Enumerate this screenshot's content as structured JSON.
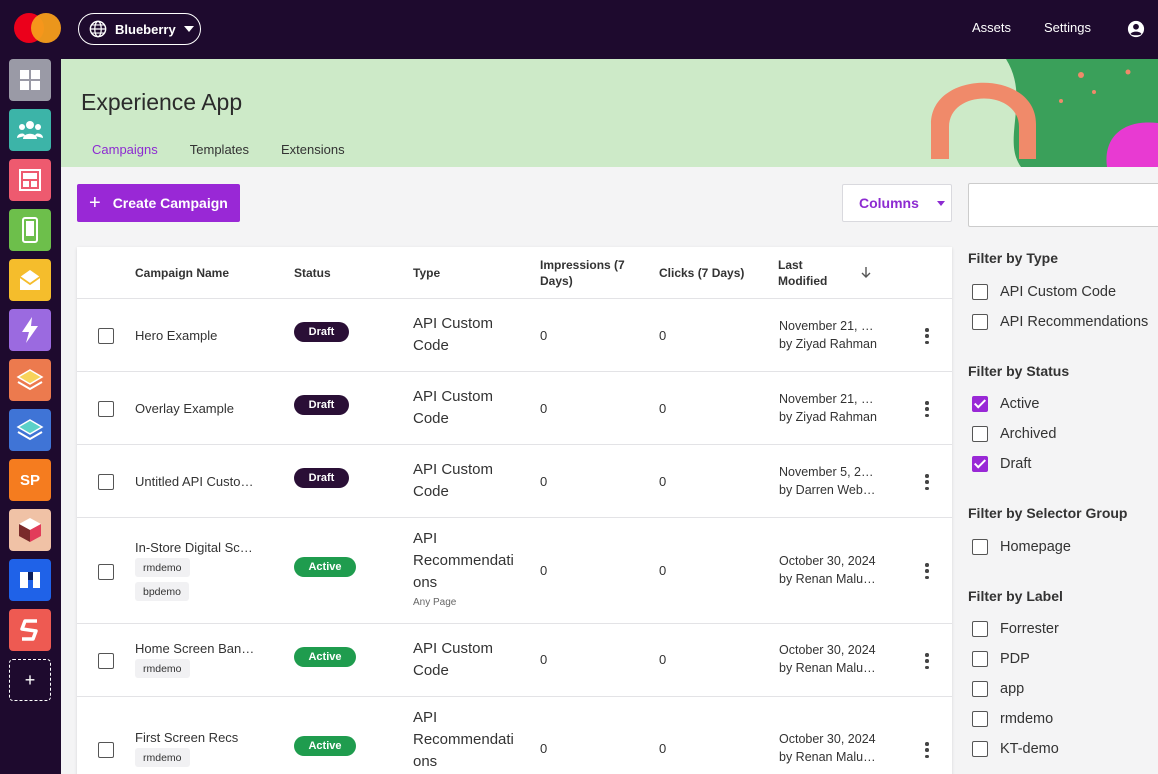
{
  "topbar": {
    "workspace": "Blueberry",
    "nav": [
      "Assets",
      "Settings"
    ]
  },
  "rail": {
    "add_label": "+",
    "sp_label": "SP"
  },
  "header": {
    "title": "Experience App",
    "tabs": [
      "Campaigns",
      "Templates",
      "Extensions"
    ],
    "active_tab": "Campaigns"
  },
  "toolbar": {
    "create_label": "Create Campaign",
    "columns_label": "Columns",
    "search_placeholder": ""
  },
  "table": {
    "headers": {
      "name": "Campaign Name",
      "status": "Status",
      "type": "Type",
      "impressions": "Impressions (7 Days)",
      "clicks": "Clicks (7 Days)",
      "modified": "Last Modified"
    },
    "rows": [
      {
        "name": "Hero Example",
        "status": "Draft",
        "type_l1": "API Custom",
        "type_l2": "Code",
        "type_l3": "",
        "subtype": "",
        "impressions": "0",
        "clicks": "0",
        "mod_date": "November 21, …",
        "mod_by": "by Ziyad Rahman",
        "chips": []
      },
      {
        "name": "Overlay Example",
        "status": "Draft",
        "type_l1": "API Custom",
        "type_l2": "Code",
        "type_l3": "",
        "subtype": "",
        "impressions": "0",
        "clicks": "0",
        "mod_date": "November 21, …",
        "mod_by": "by Ziyad Rahman",
        "chips": []
      },
      {
        "name": "Untitled API Custo…",
        "status": "Draft",
        "type_l1": "API Custom",
        "type_l2": "Code",
        "type_l3": "",
        "subtype": "",
        "impressions": "0",
        "clicks": "0",
        "mod_date": "November 5, 2…",
        "mod_by": "by Darren Webs…",
        "chips": []
      },
      {
        "name": "In-Store Digital Sc…",
        "status": "Active",
        "type_l1": "API",
        "type_l2": "Recommendati",
        "type_l3": "ons",
        "subtype": "Any Page",
        "impressions": "0",
        "clicks": "0",
        "mod_date": "October 30, 2024",
        "mod_by": "by Renan Malu…",
        "chips": [
          "rmdemo",
          "bpdemo"
        ]
      },
      {
        "name": "Home Screen Ban…",
        "status": "Active",
        "type_l1": "API Custom",
        "type_l2": "Code",
        "type_l3": "",
        "subtype": "",
        "impressions": "0",
        "clicks": "0",
        "mod_date": "October 30, 2024",
        "mod_by": "by Renan Malu…",
        "chips": [
          "rmdemo"
        ]
      },
      {
        "name": "First Screen Recs",
        "status": "Active",
        "type_l1": "API",
        "type_l2": "Recommendati",
        "type_l3": "ons",
        "subtype": "",
        "impressions": "0",
        "clicks": "0",
        "mod_date": "October 30, 2024",
        "mod_by": "by Renan Malu…",
        "chips": [
          "rmdemo"
        ]
      }
    ]
  },
  "filters": {
    "type": {
      "title": "Filter by Type",
      "options": [
        {
          "label": "API Custom Code",
          "checked": false
        },
        {
          "label": "API Recommendations",
          "checked": false
        }
      ]
    },
    "status": {
      "title": "Filter by Status",
      "options": [
        {
          "label": "Active",
          "checked": true
        },
        {
          "label": "Archived",
          "checked": false
        },
        {
          "label": "Draft",
          "checked": true
        }
      ]
    },
    "selector": {
      "title": "Filter by Selector Group",
      "options": [
        {
          "label": "Homepage",
          "checked": false
        }
      ]
    },
    "label": {
      "title": "Filter by Label",
      "options": [
        {
          "label": "Forrester",
          "checked": false
        },
        {
          "label": "PDP",
          "checked": false
        },
        {
          "label": "app",
          "checked": false
        },
        {
          "label": "rmdemo",
          "checked": false
        },
        {
          "label": "KT-demo",
          "checked": false
        }
      ]
    }
  },
  "colors": {
    "accent": "#9928d6",
    "topbar": "#1e0a2e",
    "header_bg": "#cdeac8",
    "draft": "#2a0f36",
    "active": "#1f9c4e"
  }
}
